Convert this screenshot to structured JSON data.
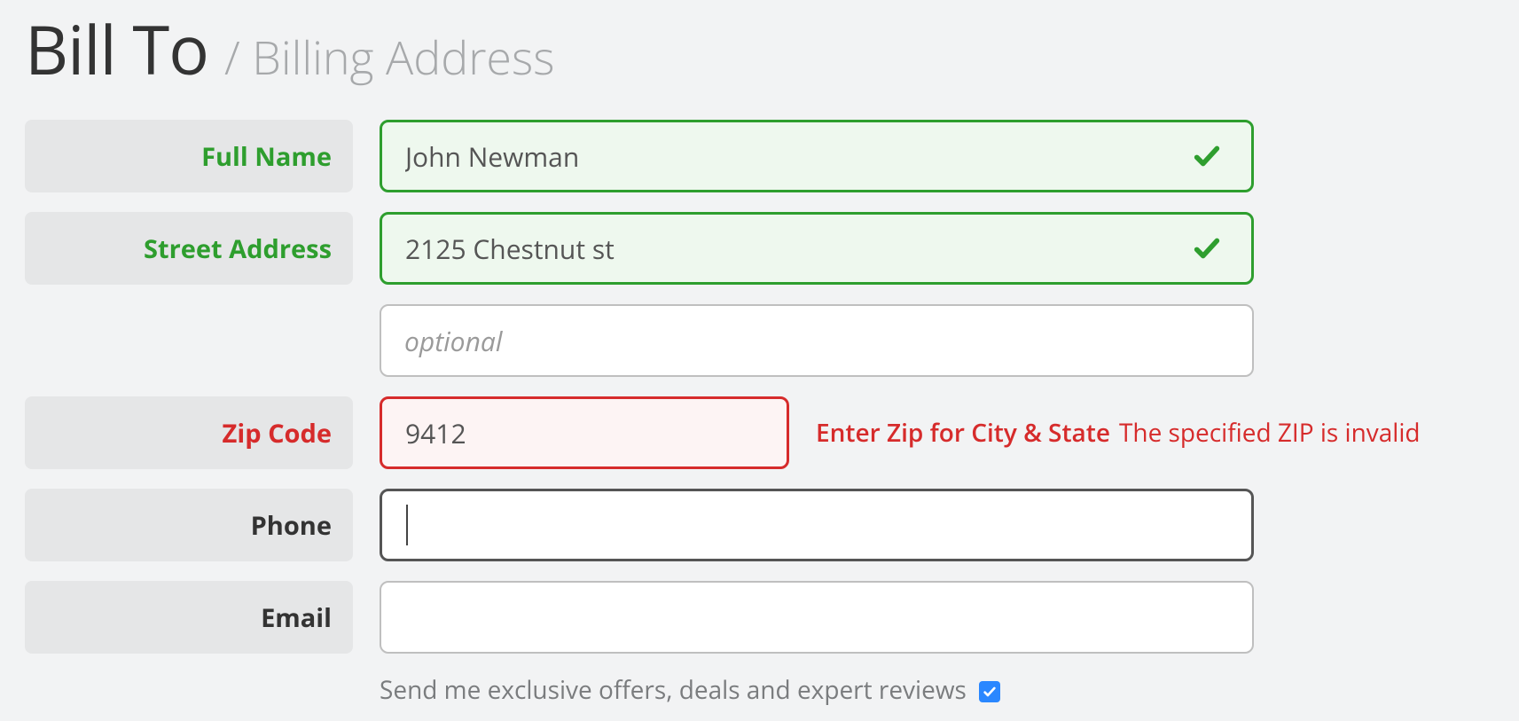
{
  "heading": {
    "main": "Bill To",
    "sub": "/ Billing Address"
  },
  "fields": {
    "full_name": {
      "label": "Full Name",
      "value": "John Newman",
      "placeholder": "",
      "state": "valid"
    },
    "street_address": {
      "label": "Street Address",
      "value": "2125 Chestnut st",
      "placeholder": "",
      "state": "valid"
    },
    "street_address2": {
      "label": "",
      "value": "",
      "placeholder": "optional",
      "state": "default"
    },
    "zip": {
      "label": "Zip Code",
      "value": "9412",
      "placeholder": "",
      "state": "error",
      "hint": "Enter Zip for City & State",
      "error": "The specified ZIP is invalid"
    },
    "phone": {
      "label": "Phone",
      "value": "",
      "placeholder": "",
      "state": "focused"
    },
    "email": {
      "label": "Email",
      "value": "",
      "placeholder": "",
      "state": "default"
    }
  },
  "consent": {
    "text": "Send me exclusive offers, deals and expert reviews",
    "checked": true
  },
  "colors": {
    "valid": "#2e9e2e",
    "error": "#d62b2b",
    "labelBg": "#e5e6e7",
    "pageBg": "#f2f3f4"
  }
}
